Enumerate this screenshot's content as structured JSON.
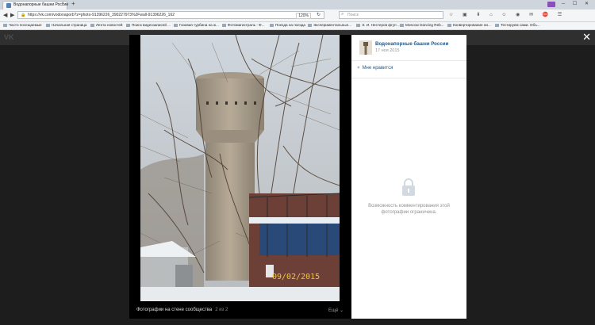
{
  "browser": {
    "tab_title": "Водонапорные башни России",
    "tab_close": "×",
    "new_tab": "+",
    "url": "https://vk.com/vodonaporb?z=photo-91396226_390227973%2Fwall-91396226_162",
    "zoom": "120%",
    "search_placeholder": "Поиск",
    "window_controls": "─ ☐ ✕",
    "toolbar_icons": "☆ ▣ ⬇ ⌂ ☺ ◉ ✉ ⛔ ☰"
  },
  "bookmarks": [
    "Часто посещаемые",
    "Начальная страница",
    "Лента новостей",
    "Поиск видеозаписей ...",
    "Газовая турбина на ж...",
    "Фотомагистраль - Ф...",
    "Поезда на поезда",
    "Экспериментальные...",
    "Э. И. Нестеров фгуп ...",
    "Moscow Dancing Reb...",
    "Конвертирование ни...",
    "Тестируем сами. Объ..."
  ],
  "vk": {
    "logo": "VK"
  },
  "viewer": {
    "close": "✕",
    "photo_date": "09/02/2015",
    "caption": "Фотографии на стене сообщества",
    "counter": "2 из 2",
    "more": "Ещё ⌄"
  },
  "panel": {
    "owner": "Водонапорные башни России",
    "date": "17 ноя 2015",
    "like_icon": "♥",
    "like": "Мне нравится",
    "comments_closed": "Возможность комментирования этой фотографии ограничена."
  },
  "colors": {
    "link": "#2a5885",
    "vk_bar": "#2f2f2f",
    "photo_stamp": "#f2c53a"
  }
}
